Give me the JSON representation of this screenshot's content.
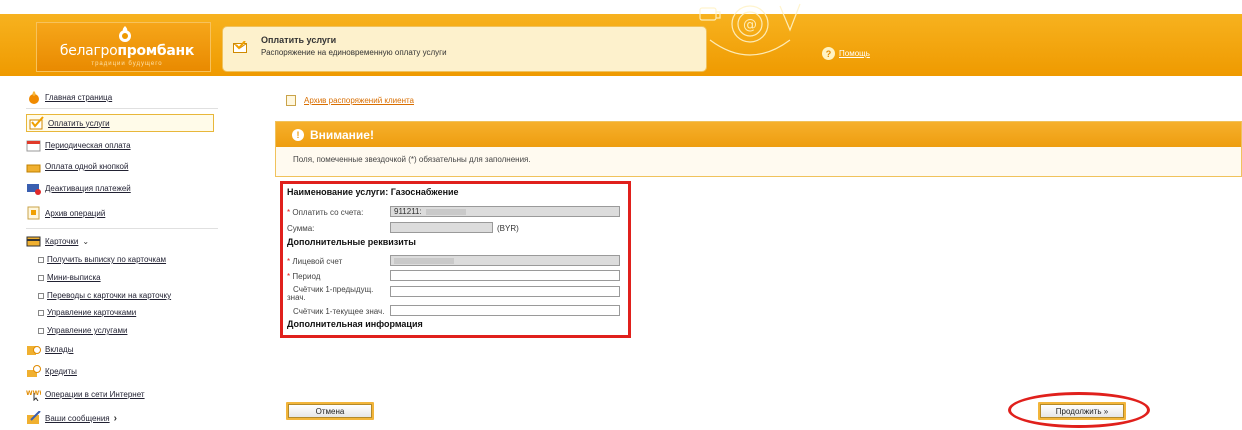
{
  "header": {
    "logo_text_light": "белагро",
    "logo_text_bold": "пром",
    "logo_text_end": "банк",
    "logo_sub": "традиции будущего",
    "service_title": "Оплатить услуги",
    "service_subtitle": "Распоряжение на единовременную оплату услуги",
    "help_icon": "?",
    "help_label": "Помощь"
  },
  "sidebar": {
    "items": [
      {
        "label": "Главная страница",
        "icon": "home-icon"
      },
      {
        "label": "Оплатить услуги",
        "icon": "pay-icon"
      },
      {
        "label": "Периодическая оплата",
        "icon": "calendar-icon"
      },
      {
        "label": "Оплата одной кнопкой",
        "icon": "one-click-icon"
      },
      {
        "label": "Деактивация платежей",
        "icon": "deactivate-icon"
      },
      {
        "label": "Архив операций",
        "icon": "archive-icon"
      },
      {
        "label": "Карточки",
        "icon": "card-icon",
        "chevron": "⌄"
      },
      {
        "label": "Вклады",
        "icon": "deposit-icon"
      },
      {
        "label": "Кредиты",
        "icon": "credit-icon"
      },
      {
        "label": "Операции в сети Интернет",
        "icon": "internet-icon"
      },
      {
        "label": "Ваши сообщения",
        "icon": "messages-icon",
        "chevron": "›"
      }
    ],
    "card_subitems": [
      "Получить выписку по карточкам",
      "Мини-выписка",
      "Переводы с карточки на карточку",
      "Управление карточками",
      "Управление услугами"
    ]
  },
  "main": {
    "archive_link": "Архив распоряжений клиента",
    "alert_title": "Внимание!",
    "alert_icon": "!",
    "alert_text": "Поля, помеченные звездочкой (*) обязательны для заполнения."
  },
  "form": {
    "service_heading": "Наименование услуги: Газоснабжение",
    "asterisk": "*",
    "pay_from_label": "Оплатить со счета:",
    "pay_from_value": "911211:",
    "sum_label": "Сумма:",
    "sum_unit": "(BYR)",
    "extra_heading": "Дополнительные реквизиты",
    "account_label": "Лицевой счет",
    "period_label": "Период",
    "meter_prev_label_1": "Счётчик 1-предыдущ.",
    "meter_prev_label_2": "знач.",
    "meter_curr_label": "Счётчик 1-текущее знач.",
    "info_heading": "Дополнительная информация"
  },
  "buttons": {
    "cancel": "Отмена",
    "continue": "Продолжить »"
  }
}
